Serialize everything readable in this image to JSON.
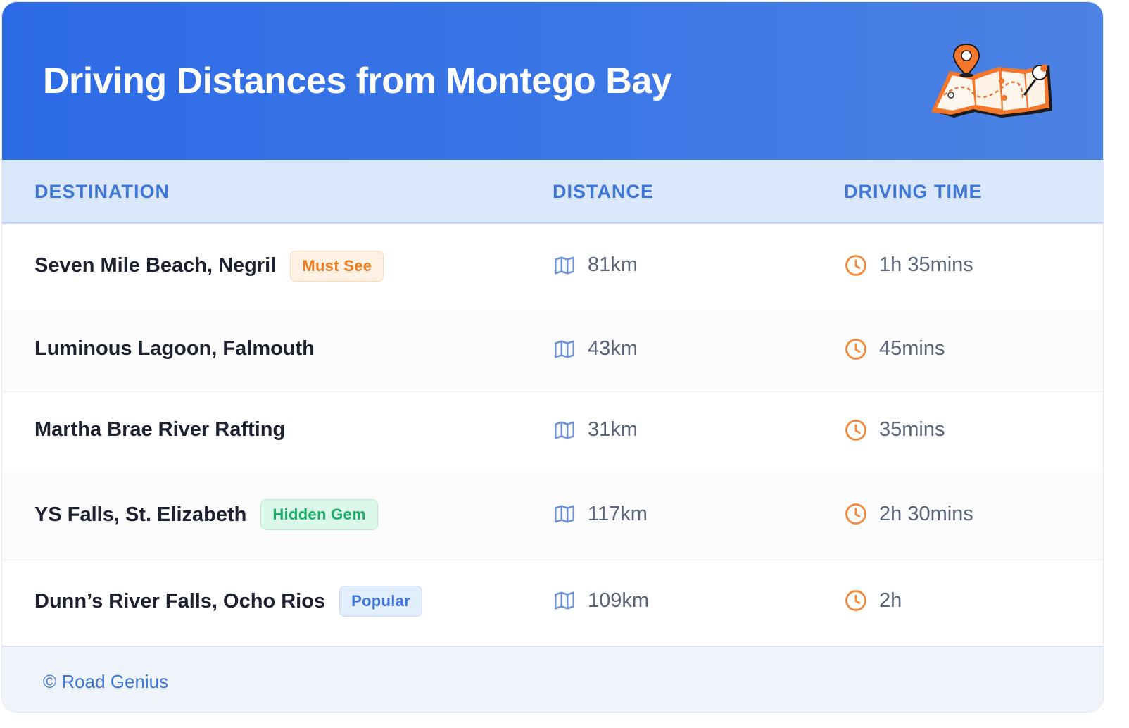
{
  "header": {
    "title": "Driving Distances from Montego Bay",
    "illustration": "map-with-pins-illustration"
  },
  "table": {
    "columns": [
      "DESTINATION",
      "DISTANCE",
      "DRIVING TIME"
    ],
    "rows": [
      {
        "destination": "Seven Mile Beach, Negril",
        "badge": "Must See",
        "badge_color": "#f07a1e",
        "distance": "81km",
        "time": "1h 35mins"
      },
      {
        "destination": "Luminous Lagoon, Falmouth",
        "badge": "",
        "badge_color": "",
        "distance": "43km",
        "time": "45mins"
      },
      {
        "destination": "Martha Brae River Rafting",
        "badge": "",
        "badge_color": "",
        "distance": "31km",
        "time": "35mins"
      },
      {
        "destination": "YS Falls, St. Elizabeth",
        "badge": "Hidden Gem",
        "badge_color": "#1dae6a",
        "distance": "117km",
        "time": "2h 30mins"
      },
      {
        "destination": "Dunn’s River Falls, Ocho Rios",
        "badge": "Popular",
        "badge_color": "#3f77d8",
        "distance": "109km",
        "time": "2h"
      }
    ],
    "icons": {
      "distance": "map-icon",
      "time": "clock-icon"
    }
  },
  "footer": {
    "text": "© Road Genius"
  },
  "colors": {
    "header_blue": "#2d6ae6",
    "accent_blue": "#3f77d8",
    "clock_orange": "#f08a3c",
    "map_icon_blue": "#6f93d8"
  }
}
